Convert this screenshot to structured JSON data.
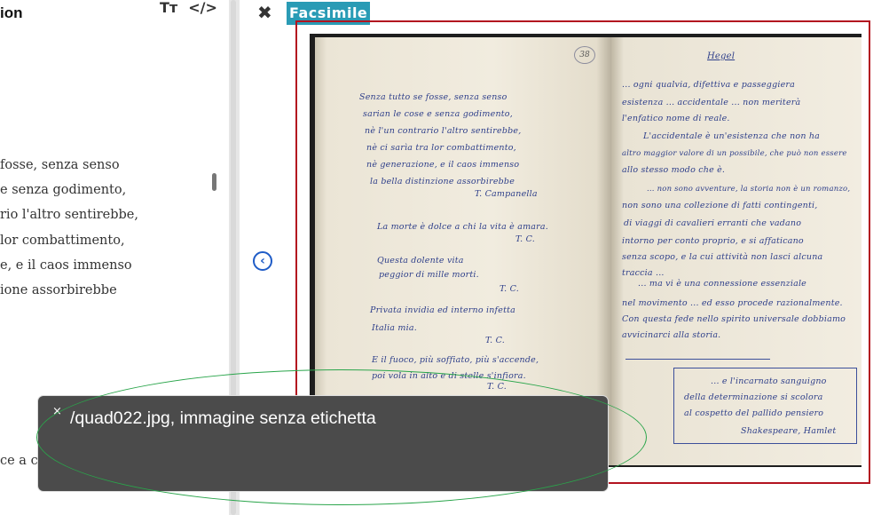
{
  "left_pane": {
    "title": "ion",
    "tools": {
      "text_size_icon": "Tт",
      "code_icon": "</>"
    },
    "poem_lines": [
      "fosse, senza senso",
      "e senza godimento,",
      "rio l'altro sentirebbe,",
      "lor combattimento,",
      "e, e il caos immenso",
      "ione assorbirebbe"
    ],
    "tail_line": "ce a ch"
  },
  "viewer": {
    "close_glyph": "✖",
    "tab_label": "Facsimile",
    "prev_glyph": "‹",
    "page_number": "38"
  },
  "manuscript_left": [
    "Senza tutto se fosse, senza senso",
    "sarian le cose e senza godimento,",
    "nè l'un contrario l'altro sentirebbe,",
    "nè ci sarìa tra lor combattimento,",
    "nè generazione, e il caos immenso",
    "la bella distinzione assorbirebbe",
    "T. Campanella",
    "La morte è dolce a chi la vita è amara.",
    "T. C.",
    "Questa dolente vita",
    "peggior di mille morti.",
    "T. C.",
    "Privata invidia ed interno infetta",
    "Italia mia.",
    "T. C.",
    "E il fuoco, più soffiato, più s'accende,",
    "poi vola in alto e di stelle s'infiora.",
    "T. C."
  ],
  "manuscript_right": [
    "Hegel",
    "... ogni qualvia, difettiva e passeggiera",
    "esistenza ... accidentale ... non meriterà",
    "l'enfatico nome di reale.",
    "L'accidentale è un'esistenza che non ha",
    "altro maggior valore di un possibile, che può non essere",
    "allo stesso modo che è.",
    "... non sono avventure, la storia non è un romanzo,",
    "non sono una collezione di fatti contingenti,",
    "di viaggi di cavalieri erranti che vadano",
    "intorno per conto proprio, e si affaticano",
    "senza scopo, e la cui attività non lasci alcuna",
    "traccia ...",
    "... ma vi è una connessione essenziale",
    "nel movimento ... ed esso procede razionalmente.",
    "Con questa fede nello spirito universale dobbiamo",
    "avvicinarci alla storia.",
    "... e l'incarnato sanguigno",
    "della determinazione si scolora",
    "al cospetto del pallido pensiero",
    "Shakespeare, Hamlet"
  ],
  "tooltip": {
    "close_glyph": "×",
    "text": "/quad022.jpg, immagine senza etichetta"
  },
  "colors": {
    "tab_bg": "#2a9bb5",
    "highlight_rect": "#b3131f",
    "highlight_ellipse": "#2aa54b",
    "ink": "#2e3f8a",
    "tooltip_bg": "#4b4b4b",
    "arrow": "#1f5cc7"
  }
}
